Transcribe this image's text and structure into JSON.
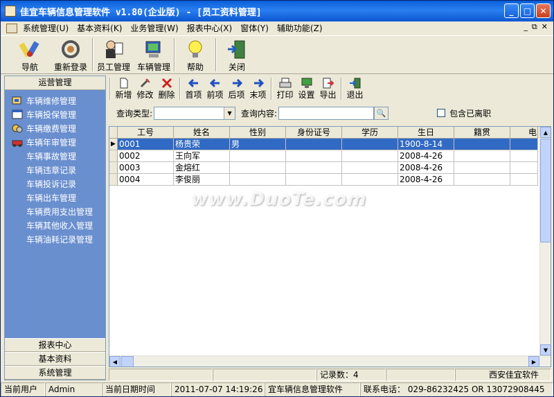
{
  "window": {
    "title": "佳宜车辆信息管理软件  v1.80(企业版)  - [员工资料管理]",
    "buttons": {
      "minimize": "_",
      "maximize": "□",
      "close": "✕"
    }
  },
  "menu": {
    "items": [
      "系统管理(U)",
      "基本资料(K)",
      "业务管理(W)",
      "报表中心(X)",
      "窗体(Y)",
      "辅助功能(Z)"
    ],
    "mdi_controls": [
      "_",
      "⧉",
      "✕"
    ]
  },
  "toolbar": {
    "items": [
      {
        "label": "导航",
        "icon": "navigation-icon"
      },
      {
        "label": "重新登录",
        "icon": "relogin-icon"
      },
      {
        "label": "员工管理",
        "icon": "employee-icon"
      },
      {
        "label": "车辆管理",
        "icon": "vehicle-icon"
      },
      {
        "label": "帮助",
        "icon": "help-bulb-icon"
      },
      {
        "label": "关闭",
        "icon": "exit-door-icon"
      }
    ]
  },
  "left_panel": {
    "header": "运营管理",
    "items": [
      {
        "label": "车辆维修管理",
        "icon": "repair-icon"
      },
      {
        "label": "车辆投保管理",
        "icon": "insurance-icon"
      },
      {
        "label": "车辆缴费管理",
        "icon": "payment-icon"
      },
      {
        "label": "车辆年审管理",
        "icon": "inspection-icon"
      },
      {
        "label": "车辆事故管理",
        "icon": ""
      },
      {
        "label": "车辆违章记录",
        "icon": ""
      },
      {
        "label": "车辆投诉记录",
        "icon": ""
      },
      {
        "label": "车辆出车管理",
        "icon": ""
      },
      {
        "label": "车辆费用支出管理",
        "icon": ""
      },
      {
        "label": "车辆其他收入管理",
        "icon": ""
      },
      {
        "label": "车辆油耗记录管理",
        "icon": ""
      }
    ],
    "footer_items": [
      "报表中心",
      "基本资料",
      "系统管理"
    ]
  },
  "subtoolbar": {
    "items": [
      {
        "label": "新增",
        "icon": "new-doc-icon"
      },
      {
        "label": "修改",
        "icon": "edit-icon"
      },
      {
        "label": "删除",
        "icon": "delete-x-icon"
      },
      {
        "label": "首项",
        "icon": "first-arrow-icon"
      },
      {
        "label": "前项",
        "icon": "prev-arrow-icon"
      },
      {
        "label": "后项",
        "icon": "next-arrow-icon"
      },
      {
        "label": "末项",
        "icon": "last-arrow-icon"
      },
      {
        "label": "打印",
        "icon": "print-icon"
      },
      {
        "label": "设置",
        "icon": "settings-monitor-icon"
      },
      {
        "label": "导出",
        "icon": "export-icon"
      },
      {
        "label": "退出",
        "icon": "exit-icon"
      }
    ]
  },
  "search": {
    "type_label": "查询类型:",
    "type_value": "",
    "content_label": "查询内容:",
    "content_value": "",
    "include_resigned_label": "包含已离职",
    "include_resigned_checked": false
  },
  "table": {
    "columns": [
      "工号",
      "姓名",
      "性别",
      "身份证号",
      "学历",
      "生日",
      "籍贯",
      "电"
    ],
    "rows": [
      [
        "0001",
        "杨贵荣",
        "男",
        "",
        "",
        "1900-8-14",
        "",
        ""
      ],
      [
        "0002",
        "王向军",
        "",
        "",
        "",
        "2008-4-26",
        "",
        ""
      ],
      [
        "0003",
        "金熔红",
        "",
        "",
        "",
        "2008-4-26",
        "",
        ""
      ],
      [
        "0004",
        "李俊丽",
        "",
        "",
        "",
        "2008-4-26",
        "",
        ""
      ]
    ],
    "selected_row": 0
  },
  "status_mid": {
    "record_count": "记录数：4",
    "company": "西安佳宜软件"
  },
  "statusbar": {
    "user_label": "当前用户",
    "user_value": "Admin",
    "date_label": "当前日期时间",
    "date_value": "2011-07-07 14:19:26",
    "app_name": "宜车辆信息管理软件",
    "contact": "联系电话：  029-86232425   OR   13072908445"
  },
  "watermark": "www.DuoTe.com",
  "colors": {
    "title_bar": "#0a5fd8",
    "left_panel": "#6a8fcf",
    "selection": "#316ac5"
  }
}
